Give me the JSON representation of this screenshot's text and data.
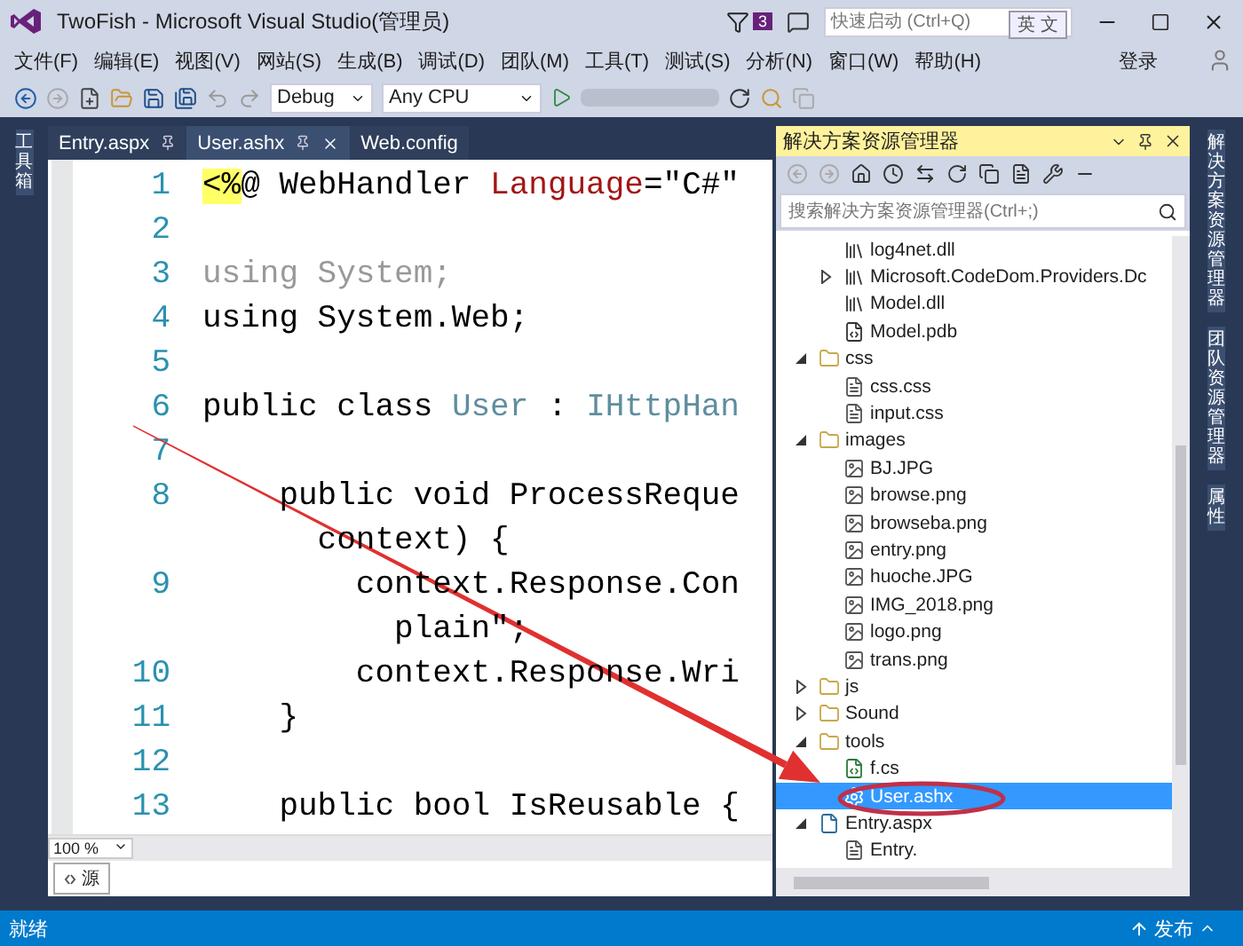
{
  "title_bar": {
    "title": "TwoFish - Microsoft Visual Studio(管理员)",
    "notification_count": "3",
    "quick_launch": {
      "placeholder": "快速启动 (Ctrl+Q)"
    },
    "ime_indicator": "英 文"
  },
  "menu": [
    "文件(F)",
    "编辑(E)",
    "视图(V)",
    "网站(S)",
    "生成(B)",
    "调试(D)",
    "团队(M)",
    "工具(T)",
    "测试(S)",
    "分析(N)",
    "窗口(W)",
    "帮助(H)"
  ],
  "account": "登录",
  "toolbar": {
    "configuration": "Debug",
    "platform": "Any CPU"
  },
  "left_strip": [
    "工具箱"
  ],
  "tabs": [
    {
      "label": "Entry.aspx",
      "selected": false,
      "pinned": true
    },
    {
      "label": "User.ashx",
      "selected": true,
      "pinned": true
    },
    {
      "label": "Web.config",
      "selected": false,
      "pinned": false
    }
  ],
  "editor": {
    "lines": [
      {
        "number": "1",
        "segments": [
          {
            "text": "<%",
            "kind": "directive"
          },
          {
            "text": "@ WebHandler ",
            "kind": "plain"
          },
          {
            "text": "Language",
            "kind": "attribute"
          },
          {
            "text": "=\"C#\"",
            "kind": "plain"
          }
        ]
      },
      {
        "number": "2"
      },
      {
        "number": "3",
        "segments": [
          {
            "text": "using System;",
            "kind": "unused"
          }
        ]
      },
      {
        "number": "4",
        "segments": [
          {
            "text": "using System.Web;",
            "kind": "plain"
          }
        ]
      },
      {
        "number": "5"
      },
      {
        "number": "6",
        "segments": [
          {
            "text": "public class ",
            "kind": "plain"
          },
          {
            "text": "User",
            "kind": "type"
          },
          {
            "text": " : ",
            "kind": "plain"
          },
          {
            "text": "IHttpHan",
            "kind": "type"
          }
        ]
      },
      {
        "number": "7"
      },
      {
        "number": "8",
        "segments": [
          {
            "text": "    public void ProcessReque",
            "kind": "plain"
          }
        ]
      },
      {
        "segments": [
          {
            "text": "      context) {",
            "kind": "plain"
          }
        ]
      },
      {
        "number": "9",
        "segments": [
          {
            "text": "        context.Response.Con",
            "kind": "plain"
          }
        ]
      },
      {
        "segments": [
          {
            "text": "          plain\";",
            "kind": "plain"
          }
        ]
      },
      {
        "number": "10",
        "segments": [
          {
            "text": "        context.Response.Wri",
            "kind": "plain"
          }
        ]
      },
      {
        "number": "11",
        "segments": [
          {
            "text": "    }",
            "kind": "plain"
          }
        ]
      },
      {
        "number": "12"
      },
      {
        "number": "13",
        "segments": [
          {
            "text": "    public bool IsReusable {",
            "kind": "plain"
          }
        ]
      }
    ],
    "zoom": "100 %",
    "view_tab": "源"
  },
  "solution_explorer": {
    "title": "解决方案资源管理器",
    "search": {
      "placeholder": "搜索解决方案资源管理器(Ctrl+;)"
    },
    "tree": [
      {
        "children": [
          {
            "label": "log4net.dll",
            "kind": "assembly",
            "selected": false
          },
          {
            "label": "Microsoft.CodeDom.Providers.Dc",
            "kind": "assembly",
            "selected": false,
            "expanded": false
          },
          {
            "label": "Model.dll",
            "kind": "assembly",
            "selected": false
          },
          {
            "label": "Model.pdb",
            "kind": "pdb",
            "selected": false
          }
        ]
      },
      {
        "label": "css",
        "kind": "folder",
        "selected": false,
        "expanded": true,
        "children": [
          {
            "label": "css.css",
            "kind": "css",
            "selected": false
          },
          {
            "label": "input.css",
            "kind": "css",
            "selected": false
          }
        ]
      },
      {
        "label": "images",
        "kind": "folder",
        "selected": false,
        "expanded": true,
        "children": [
          {
            "label": "BJ.JPG",
            "kind": "image",
            "selected": false
          },
          {
            "label": "browse.png",
            "kind": "image",
            "selected": false
          },
          {
            "label": "browseba.png",
            "kind": "image",
            "selected": false
          },
          {
            "label": "entry.png",
            "kind": "image",
            "selected": false
          },
          {
            "label": "huoche.JPG",
            "kind": "image",
            "selected": false
          },
          {
            "label": "IMG_2018.png",
            "kind": "image",
            "selected": false
          },
          {
            "label": "logo.png",
            "kind": "image",
            "selected": false
          },
          {
            "label": "trans.png",
            "kind": "image",
            "selected": false
          }
        ]
      },
      {
        "label": "js",
        "kind": "folder",
        "selected": false,
        "expanded": false
      },
      {
        "label": "Sound",
        "kind": "folder",
        "selected": false,
        "expanded": false
      },
      {
        "label": "tools",
        "kind": "folder",
        "selected": false,
        "expanded": true,
        "children": [
          {
            "label": "f.cs",
            "kind": "cs",
            "selected": false
          },
          {
            "label": "User.ashx",
            "kind": "handler",
            "selected": true
          }
        ]
      },
      {
        "label": "Entry.aspx",
        "kind": "aspx",
        "selected": false,
        "expanded": true,
        "children": [
          {
            "label": "Entry.",
            "kind": "designer",
            "selected": false
          }
        ]
      }
    ]
  },
  "right_strip": [
    "解决方案资源管理器",
    "团队资源管理器",
    "属性"
  ],
  "status_bar": {
    "text": "就绪",
    "publish": "发布"
  }
}
